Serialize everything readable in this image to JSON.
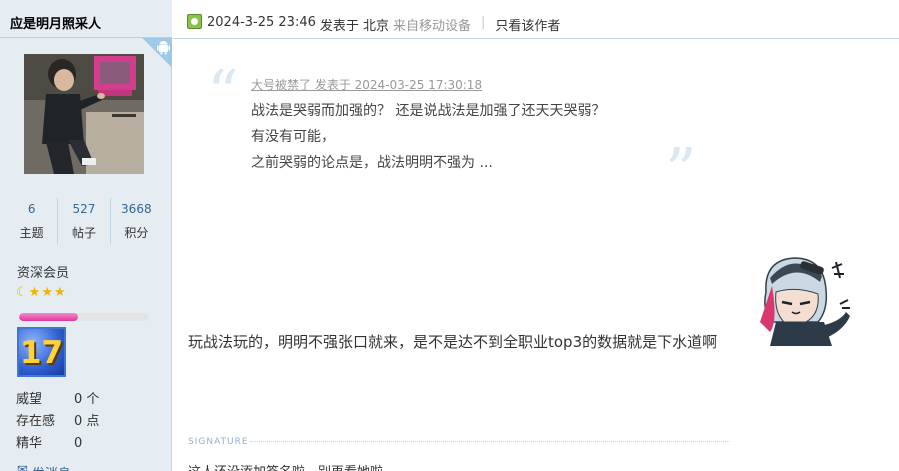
{
  "user": {
    "name": "应是明月照采人",
    "stats": [
      {
        "value": "6",
        "label": "主题"
      },
      {
        "value": "527",
        "label": "帖子"
      },
      {
        "value": "3668",
        "label": "积分"
      }
    ],
    "group": "资深会员",
    "level_progress_percent": 45,
    "medal_number": "17",
    "info": [
      {
        "key": "威望",
        "value": "0 个"
      },
      {
        "key": "存在感",
        "value": "0 点"
      },
      {
        "key": "精华",
        "value": "0"
      }
    ],
    "send_message": "发消息"
  },
  "post": {
    "datetime": "2024-3-25 23:46",
    "posted_in": "发表于 北京",
    "source": "来自移动设备",
    "separator": "|",
    "author_only": "只看该作者"
  },
  "quote": {
    "meta": "大号被禁了 发表于 2024-03-25 17:30:18",
    "lines": [
      "战法是哭弱而加强的？ 还是说战法是加强了还天天哭弱？",
      "有没有可能，",
      "之前哭弱的论点是，战法明明不强为 ..."
    ]
  },
  "message": "玩战法玩的，明明不强张口就来，是不是达不到全职业top3的数据就是下水道啊",
  "signature": {
    "label": "SIGNATURE",
    "text": "这人还没添加签名啦，别再看她啦"
  },
  "colors": {
    "sidebar_bg": "#e5edf2",
    "border": "#c2d5e3",
    "link": "#336699",
    "progress": "#e2389f",
    "online_icon": "#8bc34a"
  }
}
